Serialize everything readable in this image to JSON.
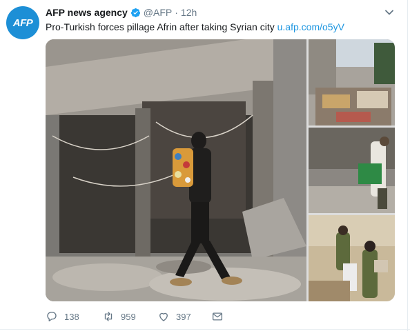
{
  "tweet": {
    "author_name": "AFP news agency",
    "author_handle": "@AFP",
    "separator": "·",
    "time": "12h",
    "avatar_text": "AFP",
    "text": "Pro-Turkish forces pillage Afrin after taking Syrian city",
    "link_text": "u.afp.com/o5yV"
  },
  "actions": {
    "replies": "138",
    "retweets": "959",
    "likes": "397"
  },
  "colors": {
    "brand_blue": "#1da1f2",
    "link": "#1b95e0",
    "muted": "#657786"
  },
  "icons": [
    "verified-badge-icon",
    "caret-down-icon",
    "reply-icon",
    "retweet-icon",
    "like-icon",
    "direct-message-icon"
  ]
}
